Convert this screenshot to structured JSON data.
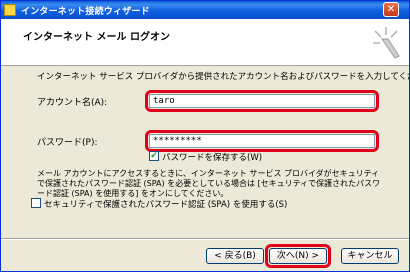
{
  "window": {
    "title": "インターネット接続ウィザード",
    "close_glyph": "✕"
  },
  "header": {
    "title": "インターネット メール ログオン"
  },
  "instruction": "インターネット サービス プロバイダから提供されたアカウント名およびパスワードを入力してください。",
  "account": {
    "label": "アカウント名(A):",
    "value": "taro"
  },
  "password": {
    "label": "パスワード(P):",
    "value": "*********"
  },
  "save_password": {
    "label": "パスワードを保存する(W)",
    "checked": true
  },
  "note": "メール アカウントにアクセスするときに、インターネット サービス プロバイダがセキュリティで保護されたパスワード認証 (SPA) を必要としている場合は [セキュリティで保護されたパスワード認証 (SPA) を使用する] をオンにしてください。",
  "spa": {
    "label": "セキュリティで保護されたパスワード認証 (SPA) を使用する(S)",
    "checked": false
  },
  "buttons": {
    "back": "< 戻る(B)",
    "next": "次へ(N) >",
    "cancel": "キャンセル"
  },
  "colors": {
    "highlight": "#e0001a",
    "titlebar": "#0a5fd8",
    "dialog_bg": "#ece9d8"
  },
  "icons": {
    "title": "wizard-app-icon",
    "header": "wizard-sparkle-icon"
  }
}
